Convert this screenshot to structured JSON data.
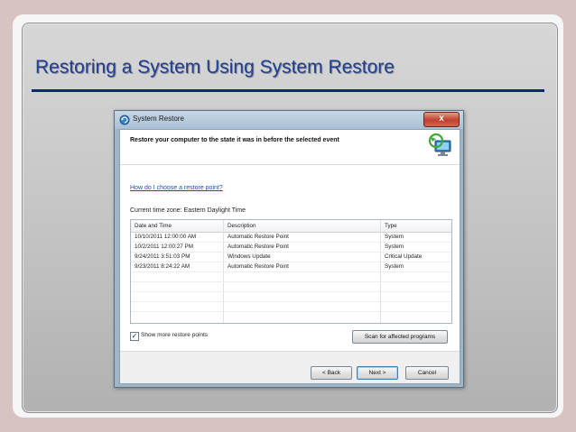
{
  "slide": {
    "title": "Restoring a System Using System Restore"
  },
  "window": {
    "title": "System Restore",
    "close_glyph": "x",
    "icon": "system-restore-icon",
    "header_text": "Restore your computer to the state it was in before the selected event",
    "help_link": "How do I choose a restore point?",
    "timezone": "Current time zone: Eastern Daylight Time",
    "grid": {
      "columns": [
        "Date and Time",
        "Description",
        "Type"
      ],
      "rows": [
        {
          "date": "10/10/2011 12:00:00 AM",
          "description": "Automatic Restore Point",
          "type": "System"
        },
        {
          "date": "10/2/2011 12:00:27 PM",
          "description": "Automatic Restore Point",
          "type": "System"
        },
        {
          "date": "9/24/2011 3:51:03 PM",
          "description": "Windows Update",
          "type": "Critical Update"
        },
        {
          "date": "9/23/2011 8:24:22 AM",
          "description": "Automatic Restore Point",
          "type": "System"
        }
      ]
    },
    "show_more": {
      "label": "Show more restore points",
      "checked": true,
      "check_glyph": "✓"
    },
    "scan_button": "Scan for affected programs",
    "back_button": "< Back",
    "next_button": "Next >",
    "cancel_button": "Cancel"
  },
  "colors": {
    "title": "#1f3f90",
    "rule": "#0a2a78",
    "link": "#1a4fb4",
    "close": "#c0402c"
  }
}
